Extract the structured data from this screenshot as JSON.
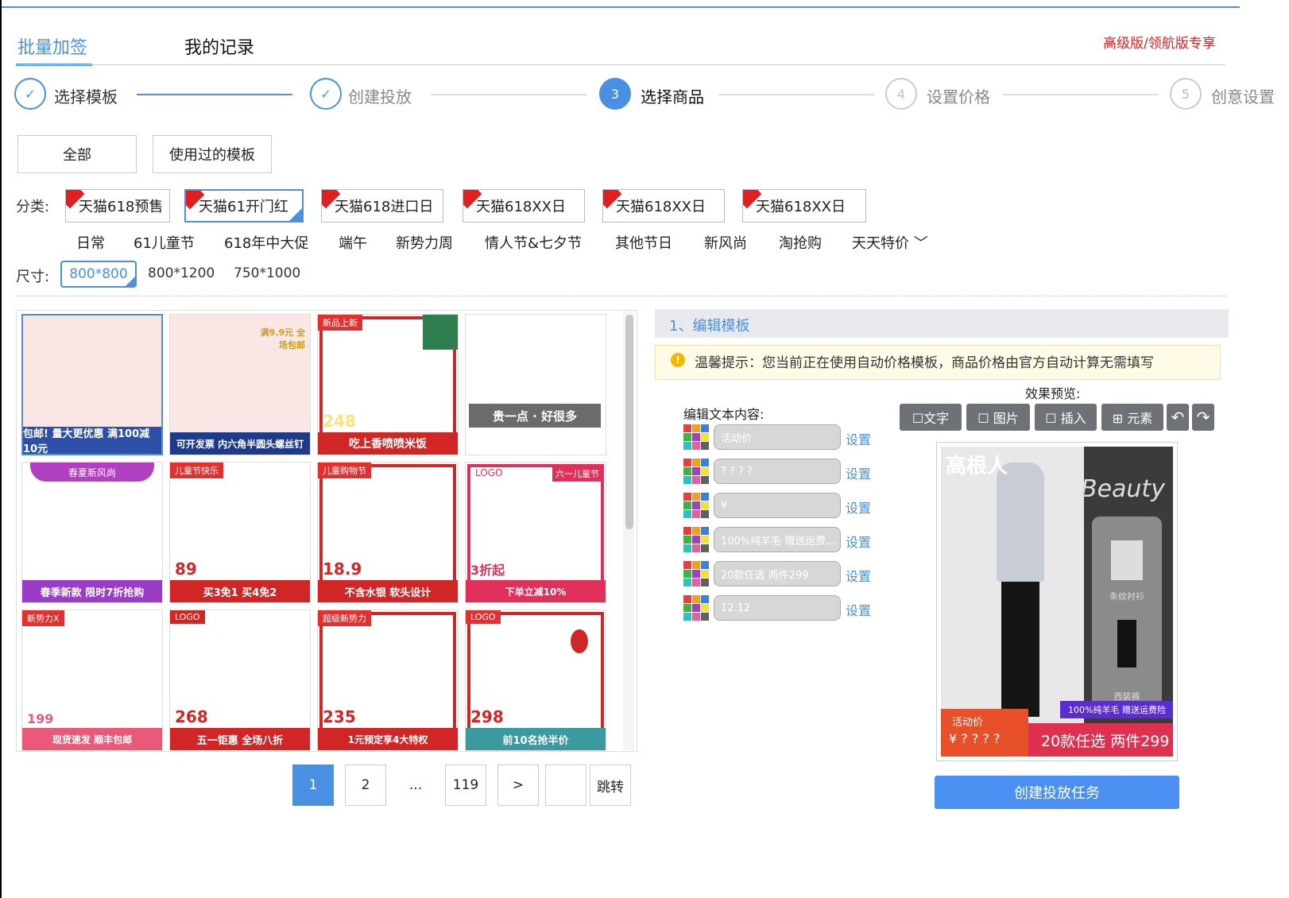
{
  "tabs": {
    "batch": "批量加签",
    "records": "我的记录"
  },
  "premium": "高级版/领航版专享",
  "steps": [
    {
      "num": "✓",
      "label": "选择模板"
    },
    {
      "num": "✓",
      "label": "创建投放"
    },
    {
      "num": "3",
      "label": "选择商品"
    },
    {
      "num": "4",
      "label": "设置价格"
    },
    {
      "num": "5",
      "label": "创意设置"
    }
  ],
  "filters": {
    "all": "全部",
    "used": "使用过的模板"
  },
  "category": {
    "label": "分类:",
    "items": [
      "天猫618预售",
      "天猫61开门红",
      "天猫618进口日",
      "天猫618XX日",
      "天猫618XX日",
      "天猫618XX日"
    ],
    "sub": [
      "日常",
      "61儿童节",
      "618年中大促",
      "端午",
      "新势力周",
      "情人节&七夕节",
      "其他节日",
      "新风尚",
      "淘抢购",
      "天天特价 ﹀"
    ]
  },
  "size": {
    "label": "尺寸:",
    "options": [
      "800*800",
      "800*1200",
      "750*1000"
    ]
  },
  "thumbs": [
    {
      "top": "",
      "bottom": "包邮! 量大更优惠  满100减10元",
      "price": ""
    },
    {
      "top": "",
      "bottom": "可开发票  内六角半圆头螺丝钉",
      "price": "",
      "corner": "满9.9元 全场包邮"
    },
    {
      "top": "新品上新",
      "bottom": "吃上香喷喷米饭",
      "price": "248"
    },
    {
      "top": "",
      "bottom": "贵一点 · 好很多",
      "price": ""
    },
    {
      "top": "春夏新风尚",
      "bottom": "春季新款 限时7折抢购",
      "price": ""
    },
    {
      "top": "儿童节快乐",
      "bottom": "买3免1 买4免2",
      "price": "89"
    },
    {
      "top": "儿童购物节",
      "bottom": "不含水银 软头设计",
      "price": "18.9"
    },
    {
      "top": "LOGO",
      "bottom": "下单立减10%",
      "price": "3折起",
      "corner": "六一儿童节"
    },
    {
      "top": "新势力X",
      "bottom": "现货速发 顺丰包邮",
      "price": "199"
    },
    {
      "top": "LOGO",
      "bottom": "五一钜惠 全场八折",
      "price": "268"
    },
    {
      "top": "超级新势力",
      "bottom": "1元预定享4大特权",
      "price": "235"
    },
    {
      "top": "LOGO",
      "bottom": "前10名抢半价",
      "price": "298"
    }
  ],
  "pager": {
    "pages": [
      "1",
      "2",
      "...",
      "119",
      ">"
    ],
    "jump": "跳转"
  },
  "panel": {
    "title": "1、编辑模板",
    "tip_icon": "!",
    "tip": "温馨提示：您当前正在使用自动价格模板，商品价格由官方自动计算无需填写",
    "preview_label": "效果预览:",
    "edit_label": "编辑文本内容:",
    "fields": [
      "活动价",
      "? ? ? ?",
      "¥",
      "100%纯羊毛 赠送运费...",
      "20款任选 两件299",
      "12.12"
    ],
    "set": "设置",
    "tools": [
      "☐文字",
      "☐ 图片",
      "☐ 插入",
      "⊞ 元素",
      "↶",
      "↷"
    ]
  },
  "preview": {
    "brand": "高根人",
    "beauty": "Beauty",
    "activity": "活动价",
    "q": "¥ ? ? ? ?",
    "ribbon": "100%纯羊毛 赠送运费险",
    "deal": "20款任选 两件299",
    "item1": "条纹衬衫",
    "item2": "西装裤"
  },
  "create_button": "创建投放任务",
  "colors": {
    "accent": "#4a90e2",
    "red": "#e02020"
  }
}
